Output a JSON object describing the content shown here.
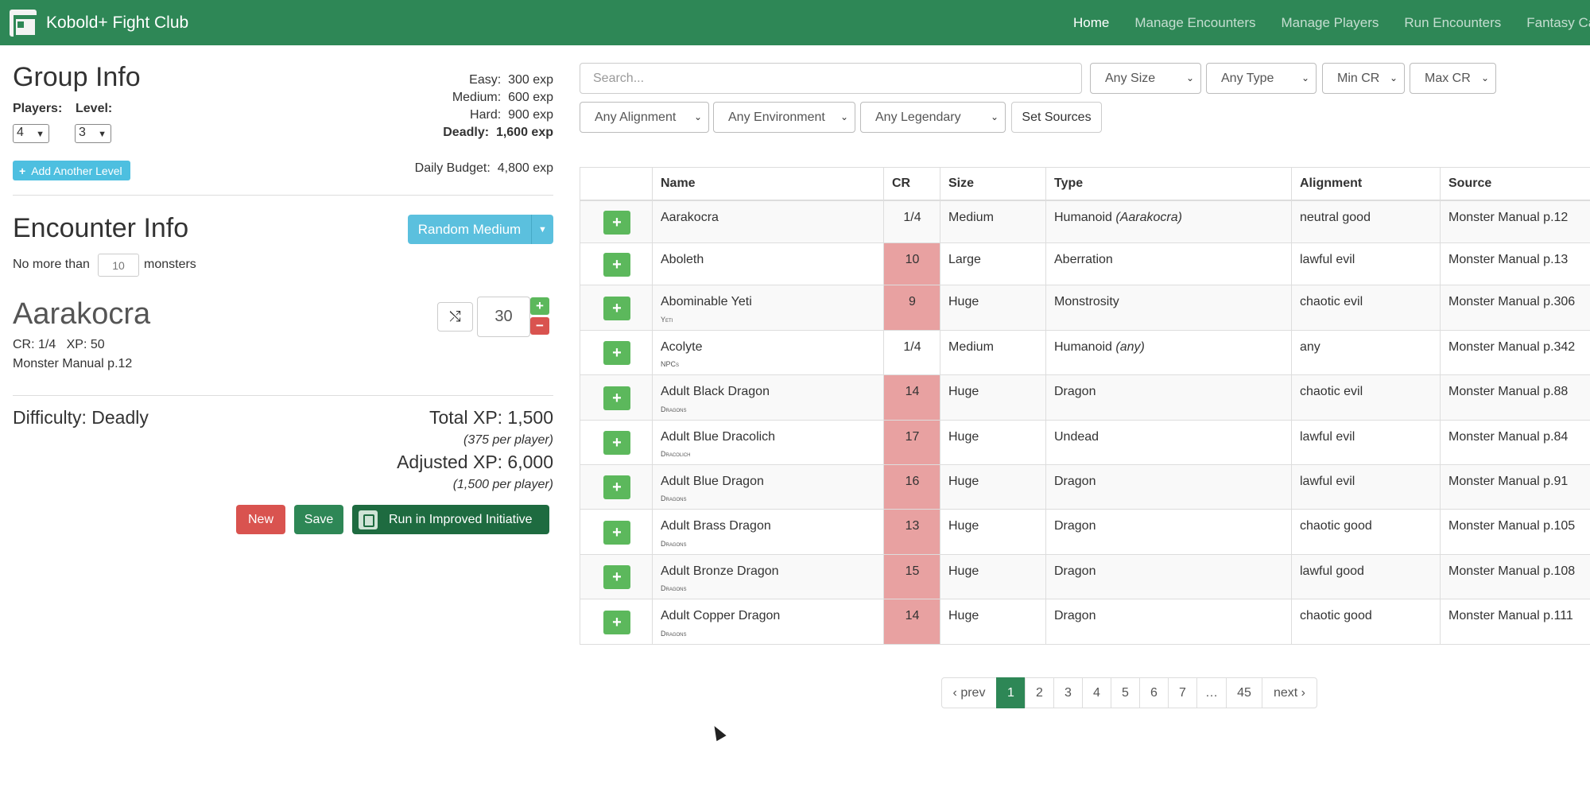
{
  "navbar": {
    "brand": "Kobold+ Fight Club",
    "links": [
      "Home",
      "Manage Encounters",
      "Manage Players",
      "Run Encounters",
      "Fantasy Cal"
    ]
  },
  "group": {
    "title": "Group Info",
    "players_label": "Players:",
    "level_label": "Level:",
    "players_value": "4",
    "level_value": "3",
    "easy_label": "Easy:",
    "easy_value": "300 exp",
    "medium_label": "Medium:",
    "medium_value": "600 exp",
    "hard_label": "Hard:",
    "hard_value": "900 exp",
    "deadly_label": "Deadly:",
    "deadly_value": "1,600 exp",
    "add_level": "Add Another Level",
    "daily_label": "Daily Budget:",
    "daily_value": "4,800 exp"
  },
  "encounter": {
    "title": "Encounter Info",
    "random_button": "Random Medium",
    "no_more_than": "No more than",
    "max_monsters": "10",
    "monsters_word": "monsters",
    "monster_name": "Aarakocra",
    "monster_cr": "CR: 1/4",
    "monster_xp": "XP: 50",
    "monster_source": "Monster Manual p.12",
    "quantity": "30",
    "difficulty": "Difficulty: Deadly",
    "total_xp": "Total XP: 1,500",
    "per_player": "(375 per player)",
    "adjusted_xp": "Adjusted XP: 6,000",
    "adjusted_per_player": "(1,500 per player)",
    "new_button": "New",
    "save_button": "Save",
    "run_button": "Run in Improved Initiative"
  },
  "filters": {
    "search_placeholder": "Search...",
    "size": "Any Size",
    "type": "Any Type",
    "min_cr": "Min CR",
    "max_cr": "Max CR",
    "alignment": "Any Alignment",
    "environment": "Any Environment",
    "legendary": "Any Legendary",
    "set_sources": "Set Sources"
  },
  "table": {
    "headers": [
      "Name",
      "CR",
      "Size",
      "Type",
      "Alignment",
      "Source"
    ],
    "rows": [
      {
        "name": "Aarakocra",
        "sub": "",
        "cr": "1/4",
        "size": "Medium",
        "type": "Humanoid",
        "subtype": "(Aarakocra)",
        "alignment": "neutral good",
        "source": "Monster Manual p.12"
      },
      {
        "name": "Aboleth",
        "sub": "",
        "cr": "10",
        "size": "Large",
        "type": "Aberration",
        "subtype": "",
        "alignment": "lawful evil",
        "source": "Monster Manual p.13"
      },
      {
        "name": "Abominable Yeti",
        "sub": "Yeti",
        "cr": "9",
        "size": "Huge",
        "type": "Monstrosity",
        "subtype": "",
        "alignment": "chaotic evil",
        "source": "Monster Manual p.306"
      },
      {
        "name": "Acolyte",
        "sub": "NPCs",
        "cr": "1/4",
        "size": "Medium",
        "type": "Humanoid",
        "subtype": "(any)",
        "alignment": "any",
        "source": "Monster Manual p.342"
      },
      {
        "name": "Adult Black Dragon",
        "sub": "Dragons",
        "cr": "14",
        "size": "Huge",
        "type": "Dragon",
        "subtype": "",
        "alignment": "chaotic evil",
        "source": "Monster Manual p.88"
      },
      {
        "name": "Adult Blue Dracolich",
        "sub": "Dracolich",
        "cr": "17",
        "size": "Huge",
        "type": "Undead",
        "subtype": "",
        "alignment": "lawful evil",
        "source": "Monster Manual p.84"
      },
      {
        "name": "Adult Blue Dragon",
        "sub": "Dragons",
        "cr": "16",
        "size": "Huge",
        "type": "Dragon",
        "subtype": "",
        "alignment": "lawful evil",
        "source": "Monster Manual p.91"
      },
      {
        "name": "Adult Brass Dragon",
        "sub": "Dragons",
        "cr": "13",
        "size": "Huge",
        "type": "Dragon",
        "subtype": "",
        "alignment": "chaotic good",
        "source": "Monster Manual p.105"
      },
      {
        "name": "Adult Bronze Dragon",
        "sub": "Dragons",
        "cr": "15",
        "size": "Huge",
        "type": "Dragon",
        "subtype": "",
        "alignment": "lawful good",
        "source": "Monster Manual p.108"
      },
      {
        "name": "Adult Copper Dragon",
        "sub": "Dragons",
        "cr": "14",
        "size": "Huge",
        "type": "Dragon",
        "subtype": "",
        "alignment": "chaotic good",
        "source": "Monster Manual p.111"
      }
    ]
  },
  "pagination": {
    "prev": "‹ prev",
    "pages": [
      "1",
      "2",
      "3",
      "4",
      "5",
      "6",
      "7",
      "…",
      "45"
    ],
    "next": "next ›",
    "current": "1"
  },
  "colors": {
    "brand_green": "#2e8756",
    "danger": "#d9534f",
    "info": "#5bc0de",
    "cr_deadly": "#e8a1a1"
  }
}
